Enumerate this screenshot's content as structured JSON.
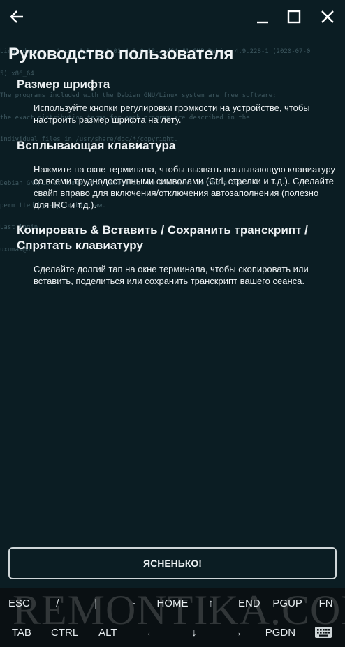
{
  "terminal_lines": [
    "Linux debian-s-1vcpu-1gb-tor1-01 4.9.0-13-amd64 #1 SMP Debian 4.9.228-1 (2020-07-0",
    "5) x86_64",
    "The programs included with the Debian GNU/Linux system are free software;",
    "the exact distribution terms for each program are described in the",
    "individual files in /usr/share/doc/*/copyright.",
    "",
    "Debian GNU/Linux comes with ABSOLUTELY NO WARRANTY, to the extent",
    "permitted by applicable law.",
    "Last login",
    "uxumax@d"
  ],
  "guide": {
    "title": "Руководство пользователя",
    "sections": [
      {
        "heading": "Размер шрифта",
        "text": "Используйте кнопки регулировки громкости на устройстве, чтобы настроить размер шрифта на лету."
      },
      {
        "heading": "Всплывающая клавиатура",
        "text": "Нажмите на окне терминала, чтобы вызвать всплывающую клавиатуру со всеми труднодоступными символами (Ctrl, стрелки и т.д.). Сделайте свайп вправо для включения/отключения автозаполнения (полезно для IRC и т.д.)."
      },
      {
        "heading": "Копировать & Вставить / Сохранить транскрипт / Спрятать клавиатуру",
        "text": "Сделайте долгий тап на окне терминала, чтобы скопировать или вставить, поделиться или сохранить транскрипт вашего сеанса."
      }
    ],
    "ok_label": "ЯСНЕНЬКО!"
  },
  "keys": {
    "row1": [
      "ESC",
      "/",
      "|",
      "-",
      "HOME",
      "↑",
      "END",
      "PGUP",
      "FN"
    ],
    "row2": [
      "TAB",
      "CTRL",
      "ALT",
      "←",
      "↓",
      "→",
      "PGDN"
    ],
    "keyboard_icon": "keyboard-icon"
  },
  "watermark": "REMONTIKA.COM"
}
